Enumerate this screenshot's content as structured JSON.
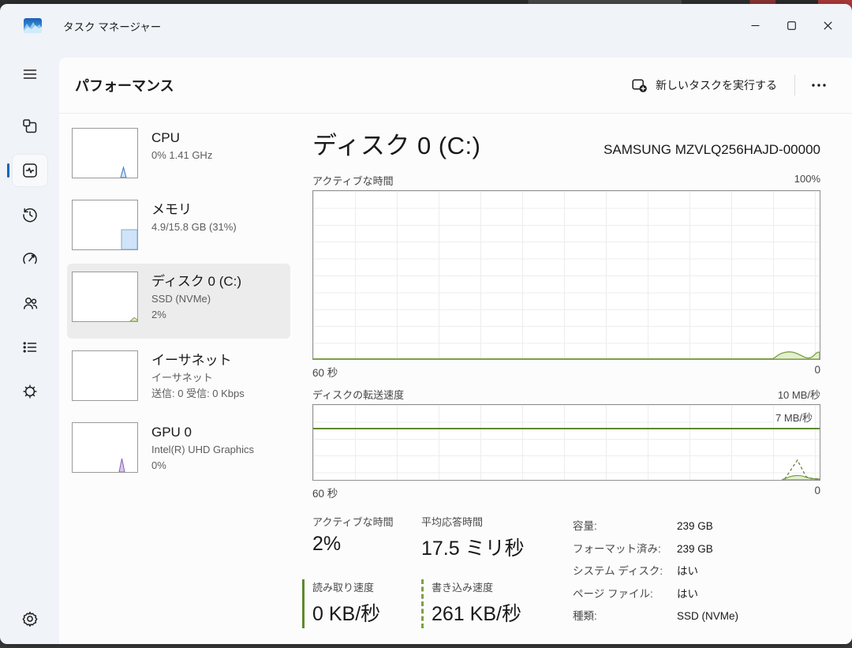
{
  "titlebar": {
    "app_title": "タスク マネージャー"
  },
  "header": {
    "title": "パフォーマンス",
    "run_new_task_label": "新しいタスクを実行する"
  },
  "sidebar": {
    "icons": [
      "menu",
      "processes",
      "performance",
      "app-history",
      "startup-apps",
      "users",
      "details",
      "services",
      "settings"
    ],
    "selected": "performance"
  },
  "perf_list": [
    {
      "title": "CPU",
      "lines": [
        "0%  1.41 GHz"
      ]
    },
    {
      "title": "メモリ",
      "lines": [
        "4.9/15.8 GB (31%)"
      ]
    },
    {
      "title": "ディスク 0 (C:)",
      "lines": [
        "SSD (NVMe)",
        "2%"
      ],
      "selected": true
    },
    {
      "title": "イーサネット",
      "lines": [
        "イーサネット",
        "送信: 0 受信: 0 Kbps"
      ]
    },
    {
      "title": "GPU 0",
      "lines": [
        "Intel(R) UHD Graphics",
        "0%"
      ]
    }
  ],
  "main": {
    "title": "ディスク 0 (C:)",
    "device": "SAMSUNG MZVLQ256HAJD-00000",
    "chart_active": {
      "label": "アクティブな時間",
      "y_max": "100%",
      "x_left": "60 秒",
      "x_right": "0"
    },
    "chart_transfer": {
      "label": "ディスクの転送速度",
      "y_max": "10 MB/秒",
      "scale_line": "7 MB/秒",
      "x_left": "60 秒",
      "x_right": "0"
    },
    "stats": {
      "active_time_label": "アクティブな時間",
      "active_time_value": "2%",
      "avg_response_label": "平均応答時間",
      "avg_response_value": "17.5 ミリ秒",
      "read_label": "読み取り速度",
      "read_value": "0 KB/秒",
      "write_label": "書き込み速度",
      "write_value": "261 KB/秒",
      "details": [
        {
          "label": "容量:",
          "value": "239 GB"
        },
        {
          "label": "フォーマット済み:",
          "value": "239 GB"
        },
        {
          "label": "システム ディスク:",
          "value": "はい"
        },
        {
          "label": "ページ ファイル:",
          "value": "はい"
        },
        {
          "label": "種類:",
          "value": "SSD (NVMe)"
        }
      ]
    }
  },
  "colors": {
    "accent": "#0067c0",
    "chart_green_stroke": "#7da045",
    "chart_green_fill": "#e3efcf",
    "scale_line_green": "#5d8a2c",
    "cpu_blue": "#3f74b8",
    "gpu_purple": "#8b5fb4"
  },
  "chart_data": [
    {
      "type": "area",
      "title": "アクティブな時間",
      "ylabel": "アクティブな時間 (%)",
      "ylim": [
        0,
        100
      ],
      "x_range": "60 秒 → 0",
      "grid": true,
      "series": [
        {
          "name": "アクティブな時間",
          "note": "ほぼ0%。直近約8秒のみ小さな山が2つ (約2〜5%)",
          "recent_values_pct": [
            0,
            2,
            4,
            3,
            1,
            3,
            4,
            3
          ]
        }
      ]
    },
    {
      "type": "area",
      "title": "ディスクの転送速度",
      "ylim": [
        0,
        10
      ],
      "y_unit": "MB/秒",
      "scale_marker": 7,
      "x_range": "60 秒 → 0",
      "grid": true,
      "series": [
        {
          "name": "書き込み速度 (破線)",
          "note": "直近にピーク約2.6 MB/秒のスパイク",
          "recent_values_mb": [
            0,
            2.6,
            0.4,
            0.1
          ]
        },
        {
          "name": "読み取り/合計 (塗りつぶし)",
          "note": "直近に小さな山 約0.7 MB/秒",
          "recent_values_mb": [
            0,
            0.7,
            0.4,
            0.1
          ]
        }
      ]
    }
  ]
}
